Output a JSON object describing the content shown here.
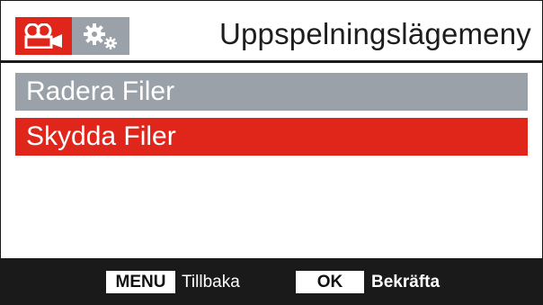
{
  "header": {
    "title": "Uppspelningslägemeny",
    "tabs": [
      {
        "icon": "video-camera-icon",
        "active": true
      },
      {
        "icon": "settings-gears-icon",
        "active": false
      }
    ]
  },
  "menu": {
    "items": [
      {
        "label": "Radera Filer",
        "selected": false
      },
      {
        "label": "Skydda Filer",
        "selected": true
      }
    ]
  },
  "footer": {
    "menu_key": "MENU",
    "menu_action": "Tillbaka",
    "ok_key": "OK",
    "ok_action": "Bekräfta"
  },
  "colors": {
    "accent_red": "#e0261b",
    "inactive_grey": "#9aa1a8",
    "footer_black": "#1a1a1a"
  }
}
